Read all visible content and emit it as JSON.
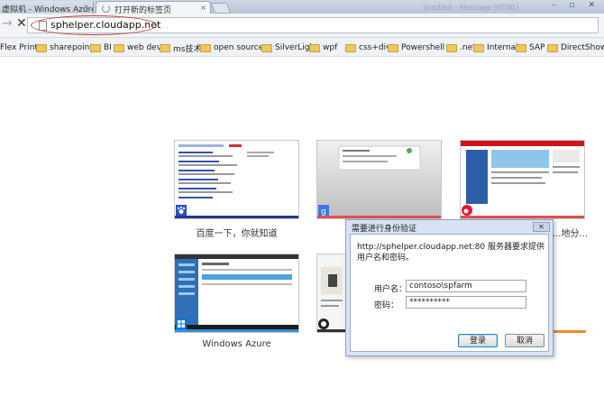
{
  "tabs": [
    {
      "label": "虚拟机 - Windows Azure",
      "close": "×"
    },
    {
      "label": "打开新的标签页",
      "close": "×"
    }
  ],
  "background_window_title": "Untitled - Message (HTML)",
  "window_buttons": "– ▫ ✕",
  "toolbar": {
    "back": "→",
    "stop": "✕",
    "url": "sphelper.cloudapp.net"
  },
  "bookmarks": [
    {
      "label": "Flex Print",
      "folder": false
    },
    {
      "label": "sharepoint",
      "folder": true
    },
    {
      "label": "BI",
      "folder": true
    },
    {
      "label": "web dev",
      "folder": true
    },
    {
      "label": "ms技术",
      "folder": true
    },
    {
      "label": "open source",
      "folder": true
    },
    {
      "label": "SilverLight",
      "folder": true
    },
    {
      "label": "wpf",
      "folder": true
    },
    {
      "label": "css+div",
      "folder": true
    },
    {
      "label": "Powershell",
      "folder": true
    },
    {
      "label": ".net",
      "folder": true
    },
    {
      "label": "Internal",
      "folder": true
    },
    {
      "label": "SAP",
      "folder": true
    },
    {
      "label": "DirectShow",
      "folder": true
    }
  ],
  "thumbnails": [
    {
      "label": "百度一下，你就知道",
      "bar_color": "#1f3a93"
    },
    {
      "label": "",
      "bar_color": "#d9534f"
    },
    {
      "label": "...地分...",
      "bar_color": "#d9534f"
    },
    {
      "label": "Windows Azure",
      "bar_color": "#2f8fd8"
    },
    {
      "label": "",
      "bar_color": "#333333"
    },
    {
      "label": "",
      "bar_color": "#f08a24"
    }
  ],
  "dialog": {
    "title": "需要进行身份验证",
    "close": "✕",
    "message": "http://sphelper.cloudapp.net:80 服务器要求提供用户名和密码。",
    "username_label": "用户名：",
    "username_value": "contoso\\spfarm",
    "password_label": "密码：",
    "password_value": "**********",
    "login_button": "登录",
    "cancel_button": "取消"
  }
}
